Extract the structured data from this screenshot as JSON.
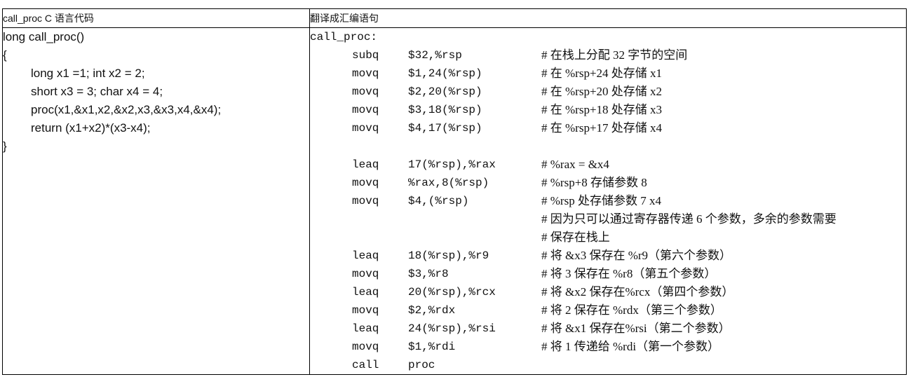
{
  "headers": {
    "left": "call_proc C 语言代码",
    "right": "翻译成汇编语句"
  },
  "c_code": [
    {
      "text": "long call_proc()",
      "indent": false
    },
    {
      "text": "{",
      "indent": false
    },
    {
      "text": "long x1 =1; int x2 = 2;",
      "indent": true
    },
    {
      "text": "short x3 = 3; char x4 = 4;",
      "indent": true
    },
    {
      "text": "proc(x1,&x1,x2,&x2,x3,&x3,x4,&x4);",
      "indent": true
    },
    {
      "text": "return (x1+x2)*(x3-x4);",
      "indent": true
    },
    {
      "text": "}",
      "indent": false
    }
  ],
  "asm": {
    "label": "call_proc:",
    "lines": [
      {
        "op": "subq",
        "args": "$32,%rsp",
        "comment": "# 在栈上分配 32 字节的空间"
      },
      {
        "op": "movq",
        "args": "$1,24(%rsp)",
        "comment": "# 在 %rsp+24 处存储 x1"
      },
      {
        "op": "movq",
        "args": "$2,20(%rsp)",
        "comment": "# 在 %rsp+20 处存储 x2"
      },
      {
        "op": "movq",
        "args": "$3,18(%rsp)",
        "comment": "# 在 %rsp+18 处存储 x3"
      },
      {
        "op": "movq",
        "args": "$4,17(%rsp)",
        "comment": "# 在 %rsp+17 处存储 x4"
      },
      {
        "op": "",
        "args": "",
        "comment": ""
      },
      {
        "op": "leaq",
        "args": "17(%rsp),%rax",
        "comment": "# %rax = &x4"
      },
      {
        "op": "movq",
        "args": "%rax,8(%rsp)",
        "comment": "# %rsp+8 存储参数 8"
      },
      {
        "op": "movq",
        "args": "$4,(%rsp)",
        "comment": "# %rsp 处存储参数 7 x4"
      },
      {
        "op": "",
        "args": "",
        "comment": "# 因为只可以通过寄存器传递 6 个参数，多余的参数需要"
      },
      {
        "op": "",
        "args": "",
        "comment": "# 保存在栈上"
      },
      {
        "op": "leaq",
        "args": "18(%rsp),%r9",
        "comment": "# 将 &x3 保存在 %r9（第六个参数）"
      },
      {
        "op": "movq",
        "args": "$3,%r8",
        "comment": "# 将 3 保存在 %r8（第五个参数）"
      },
      {
        "op": "leaq",
        "args": "20(%rsp),%rcx",
        "comment": "# 将 &x2 保存在%rcx（第四个参数）"
      },
      {
        "op": "movq",
        "args": "$2,%rdx",
        "comment": "# 将 2 保存在 %rdx（第三个参数）"
      },
      {
        "op": "leaq",
        "args": "24(%rsp),%rsi",
        "comment": "# 将 &x1 保存在%rsi（第二个参数）"
      },
      {
        "op": "movq",
        "args": "$1,%rdi",
        "comment": "# 将 1 传递给 %rdi（第一个参数）"
      },
      {
        "op": "call",
        "args": "proc",
        "comment": ""
      }
    ]
  }
}
